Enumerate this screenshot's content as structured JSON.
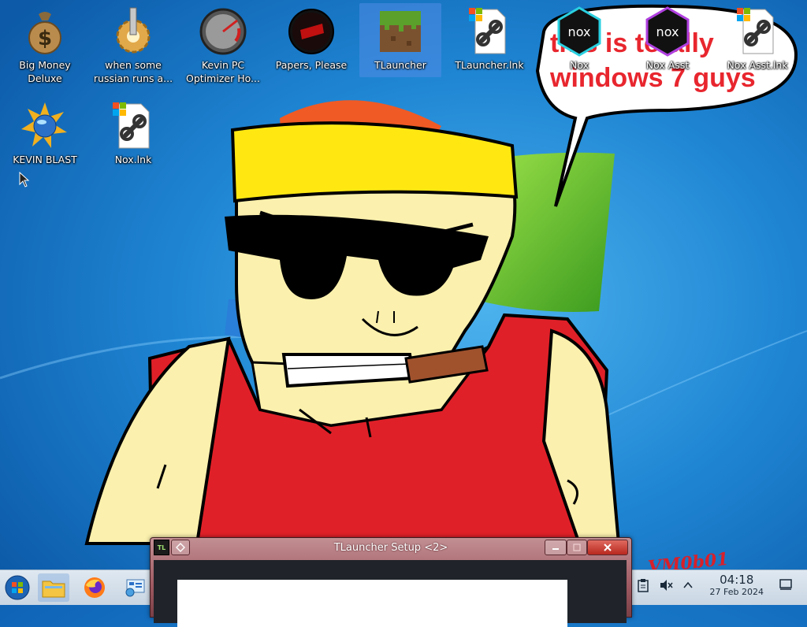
{
  "desktop": {
    "icons": [
      {
        "label": "Big Money Deluxe"
      },
      {
        "label": "when some russian runs a..."
      },
      {
        "label": "Kevin PC Optimizer Ho..."
      },
      {
        "label": "Papers, Please"
      },
      {
        "label": "TLauncher"
      },
      {
        "label": "TLauncher.lnk"
      },
      {
        "label": "Nox"
      },
      {
        "label": "Nox Asst"
      },
      {
        "label": "Nox Asst.lnk"
      },
      {
        "label": "KEVIN BLAST"
      },
      {
        "label": "Nox.lnk"
      }
    ],
    "speech_bubble_text_line1": "this is totally",
    "speech_bubble_text_line2": "windows 7 guys",
    "watermark": "VM0b01"
  },
  "window": {
    "title": "TLauncher Setup <2>",
    "app_badge": "TL"
  },
  "taskbar": {
    "time": "04:18",
    "date": "27 Feb 2024",
    "pinned": [
      "start-orb",
      "file-manager",
      "firefox",
      "control-panel"
    ]
  },
  "colors": {
    "bubble_text": "#e8262e",
    "taskbar_bg": "#d3dee9",
    "window_title_bg": "#9f5a62",
    "selection": "#508ce6"
  }
}
